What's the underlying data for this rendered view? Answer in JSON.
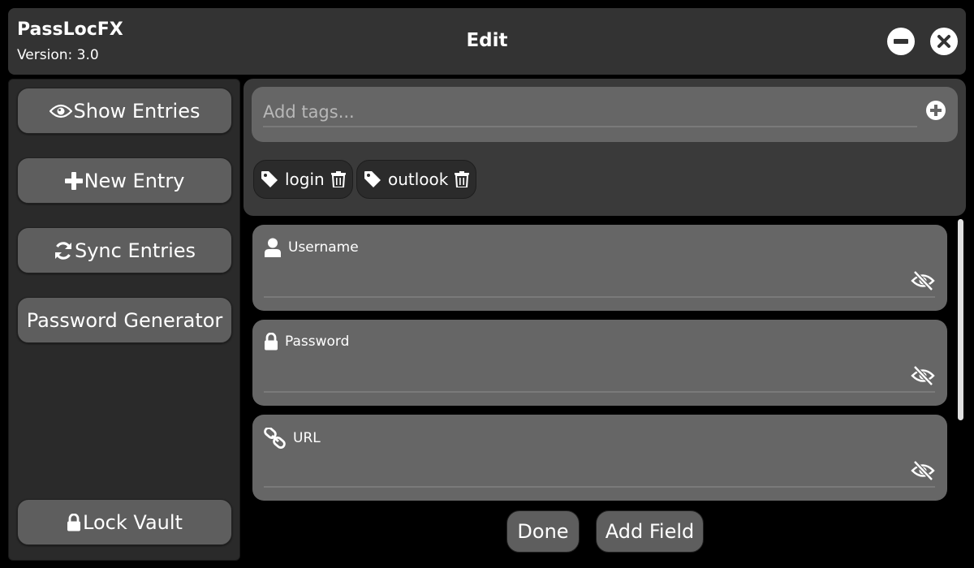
{
  "app": {
    "name": "PassLocFX",
    "version": "Version: 3.0",
    "page_title": "Edit"
  },
  "window_controls": {
    "minimize_icon": "minus-circle-icon",
    "close_icon": "x-circle-icon"
  },
  "sidebar": {
    "items": [
      {
        "label": "Show Entries",
        "icon": "eye-icon"
      },
      {
        "label": "New Entry",
        "icon": "plus-icon"
      },
      {
        "label": "Sync Entries",
        "icon": "sync-icon"
      },
      {
        "label": "Password Generator",
        "icon": ""
      },
      {
        "label": "Lock Vault",
        "icon": "lock-icon"
      }
    ]
  },
  "tags": {
    "input_placeholder": "Add tags...",
    "input_value": "",
    "chips": [
      {
        "label": "login"
      },
      {
        "label": "outlook"
      }
    ]
  },
  "fields": [
    {
      "label": "Username",
      "icon": "user-icon",
      "value": ""
    },
    {
      "label": "Password",
      "icon": "lock-icon",
      "value": ""
    },
    {
      "label": "URL",
      "icon": "link-icon",
      "value": ""
    }
  ],
  "actions": {
    "done_label": "Done",
    "add_field_label": "Add Field"
  },
  "colors": {
    "background": "#000000",
    "header": "#333333",
    "sidebar": "#2a2a2a",
    "button": "#5e5e5e",
    "card": "#666666"
  }
}
